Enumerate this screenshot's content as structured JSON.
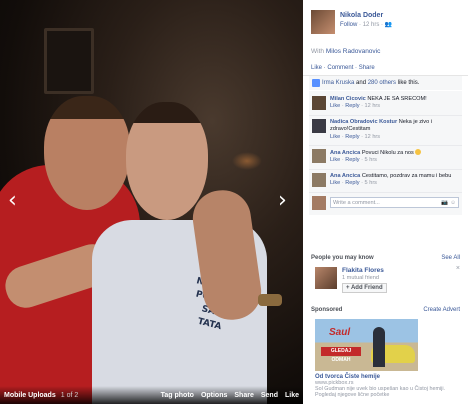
{
  "photo": {
    "shirt_text": [
      "NARODE,",
      "POSTAO SAM",
      "TATA"
    ],
    "album": "Mobile Uploads",
    "position": "1 of 2",
    "actions": [
      "Tag photo",
      "Options",
      "Share",
      "Send",
      "Like"
    ],
    "nav_prev": "‹",
    "nav_next": "›"
  },
  "post": {
    "author": "Nikola Doder",
    "follow": "Follow",
    "time": "12 hrs",
    "with_prefix": "With",
    "with_name": "Milos Radovanovic",
    "actions": [
      "Like",
      "Comment",
      "Share"
    ],
    "likes": {
      "first": "Irma Kruska",
      "and": "and",
      "others": "280 others",
      "suffix": "like this."
    }
  },
  "comments": [
    {
      "name": "Milan Cicovic",
      "text": "NEKA JE SA SRECOM!",
      "foot_like": "Like",
      "foot_reply": "Reply",
      "time": "12 hrs",
      "color": "#5b4634"
    },
    {
      "name": "Nadica Obradovic Kostur",
      "text": "Neka je zivo i zdravo!Cestitam",
      "foot_like": "Like",
      "foot_reply": "Reply",
      "time": "12 hrs",
      "color": "#3a3a44"
    },
    {
      "name": "Ana Ancica",
      "text": "Povuci Nikolu za nos",
      "foot_like": "Like",
      "foot_reply": "Reply",
      "time": "5 hrs",
      "color": "#8c7a64"
    },
    {
      "name": "Ana Ancica",
      "text": "Cestitamo, pozdrav za mamu i bebu",
      "foot_like": "Like",
      "foot_reply": "Reply",
      "time": "5 hrs",
      "color": "#8c7a64"
    }
  ],
  "write_comment": {
    "placeholder": "Write a comment..."
  },
  "pymk": {
    "title": "People you may know",
    "see_all": "See All",
    "person": {
      "name": "Flakita Flores",
      "mutual": "1 mutual friend",
      "add": "Add Friend"
    },
    "close": "×"
  },
  "ads": {
    "title": "Sponsored",
    "create": "Create Advert",
    "banner_title": "Saul",
    "banner_sub": "GLEDAJ ODMAH",
    "ad_title": "Od tvorca Čiste hemije",
    "ad_url": "www.pickbox.rs",
    "ad_desc": "Sol Gudman nije uvek bio uspešan kao u Čistoj hemiji. Pogledaj njegove lične početke"
  }
}
